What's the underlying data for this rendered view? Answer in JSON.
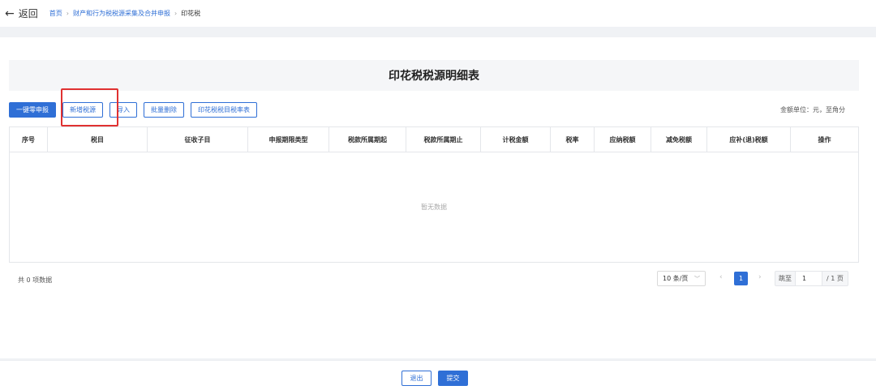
{
  "header": {
    "back_label": "返回",
    "breadcrumb": [
      "首页",
      "财产和行为税税源采集及合并申报",
      "印花税"
    ]
  },
  "page_title": "印花税税源明细表",
  "toolbar": {
    "zero_declare": "一键零申报",
    "add_source": "新增税源",
    "import": "导入",
    "batch_delete": "批量删除",
    "rate_table": "印花税税目税率表"
  },
  "unit_note": "金额单位：元，至角分",
  "table": {
    "columns": [
      "序号",
      "税目",
      "征收子目",
      "申报期限类型",
      "税款所属期起",
      "税款所属期止",
      "计税金额",
      "税率",
      "应纳税额",
      "减免税额",
      "应补(退)税额",
      "操作"
    ],
    "empty_text": "暂无数据"
  },
  "pagination": {
    "total_text": "共 0 项数据",
    "page_size": "10 条/页",
    "current_page": "1",
    "jump_label": "跳至",
    "jump_value": "1",
    "total_pages": "/ 1 页"
  },
  "footer": {
    "exit": "退出",
    "submit": "提交"
  },
  "colors": {
    "primary": "#2f6fd6",
    "highlight": "#e03131"
  }
}
